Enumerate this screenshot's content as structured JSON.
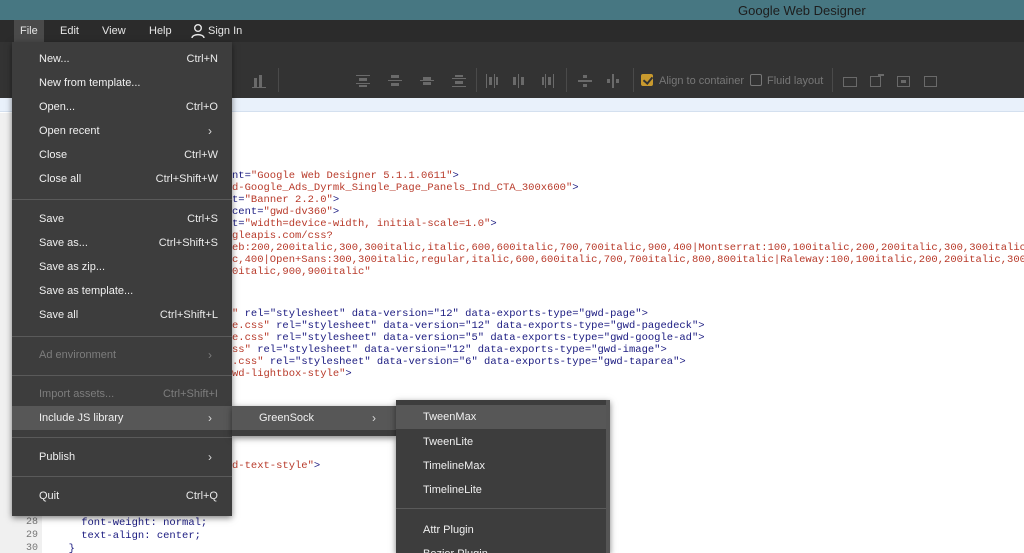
{
  "window": {
    "title": "Google Web Designer"
  },
  "menubar": {
    "items": [
      "File",
      "Edit",
      "View",
      "Help"
    ],
    "signin": "Sign In"
  },
  "toolbar": {
    "align_to_container": "Align to container",
    "fluid_layout": "Fluid layout",
    "align_checked": true,
    "fluid_checked": false
  },
  "code": {
    "lines": [
      {
        "plain": "nt=",
        "attr": "\"Google Web Designer 5.1.1.0611\"",
        "tail": ">"
      },
      {
        "plain": "",
        "attr": "d-Google_Ads_Dyrmk_Single_Page_Panels_Ind_CTA_300x600\"",
        "tail": ">"
      },
      {
        "plain": "t=",
        "attr": "\"Banner 2.2.0\"",
        "tail": ">"
      },
      {
        "plain": "cent=",
        "attr": "\"gwd-dv360\"",
        "tail": ">"
      },
      {
        "plain": "t=",
        "attr": "\"width=device-width, initial-scale=1.0\"",
        "tail": ">"
      },
      {
        "plain": "",
        "attr": "gleapis.com/css?",
        "tail": ""
      },
      {
        "plain": "",
        "attr": "eb:200,200italic,300,300italic,italic,600,600italic,700,700italic,900,400|Montserrat:100,100italic,200,200italic,300,300italic,it",
        "tail": ""
      },
      {
        "plain": "",
        "attr": "c,400|Open+Sans:300,300italic,regular,italic,600,600italic,700,700italic,800,800italic|Raleway:100,100italic,200,200italic,300,3",
        "tail": ""
      },
      {
        "plain": "",
        "attr": "0italic,900,900italic\"",
        "tail": ""
      },
      {
        "plain": "",
        "attr": "",
        "tail": ""
      },
      {
        "plain": "",
        "attr": "\"",
        "tail": " rel=\"stylesheet\" data-version=\"12\" data-exports-type=\"gwd-page\">"
      },
      {
        "plain": "",
        "attr": "e.css\"",
        "tail": " rel=\"stylesheet\" data-version=\"12\" data-exports-type=\"gwd-pagedeck\">"
      },
      {
        "plain": "",
        "attr": "e.css\"",
        "tail": " rel=\"stylesheet\" data-version=\"5\" data-exports-type=\"gwd-google-ad\">"
      },
      {
        "plain": "",
        "attr": "ss\"",
        "tail": " rel=\"stylesheet\" data-version=\"12\" data-exports-type=\"gwd-image\">"
      },
      {
        "plain": "",
        "attr": ".css\"",
        "tail": " rel=\"stylesheet\" data-version=\"6\" data-exports-type=\"gwd-taparea\">"
      },
      {
        "plain": "",
        "attr": "wd-lightbox-style\"",
        "tail": ">"
      }
    ],
    "textstyle": {
      "attr": "d-text-style\"",
      "tail": ">"
    },
    "bottom": [
      {
        "num": "28",
        "text": "    font-weight: normal;"
      },
      {
        "num": "29",
        "text": "    text-align: center;"
      },
      {
        "num": "30",
        "text": "  }"
      }
    ]
  },
  "file_menu": {
    "items": [
      {
        "label": "New...",
        "shortcut": "Ctrl+N"
      },
      {
        "label": "New from template...",
        "shortcut": ""
      },
      {
        "label": "Open...",
        "shortcut": "Ctrl+O"
      },
      {
        "label": "Open recent",
        "shortcut": ""
      },
      {
        "label": "Close",
        "shortcut": "Ctrl+W"
      },
      {
        "label": "Close all",
        "shortcut": "Ctrl+Shift+W"
      },
      {
        "label": "Save",
        "shortcut": "Ctrl+S"
      },
      {
        "label": "Save as...",
        "shortcut": "Ctrl+Shift+S"
      },
      {
        "label": "Save as zip...",
        "shortcut": ""
      },
      {
        "label": "Save as template...",
        "shortcut": ""
      },
      {
        "label": "Save all",
        "shortcut": "Ctrl+Shift+L"
      },
      {
        "label": "Ad environment",
        "shortcut": ""
      },
      {
        "label": "Import assets...",
        "shortcut": "Ctrl+Shift+I"
      },
      {
        "label": "Include JS library",
        "shortcut": ""
      },
      {
        "label": "Publish",
        "shortcut": ""
      },
      {
        "label": "Quit",
        "shortcut": "Ctrl+Q"
      }
    ]
  },
  "js_submenu": {
    "items": [
      "GreenSock"
    ]
  },
  "greensock_submenu": {
    "items": [
      "TweenMax",
      "TweenLite",
      "TimelineMax",
      "TimelineLite",
      "Attr Plugin",
      "Bezier Plugin"
    ]
  },
  "colors": {
    "titlebar": "#477782",
    "menu_bg": "#3d3d3d",
    "highlight": "#575757",
    "accent_check": "#c99a2e"
  }
}
